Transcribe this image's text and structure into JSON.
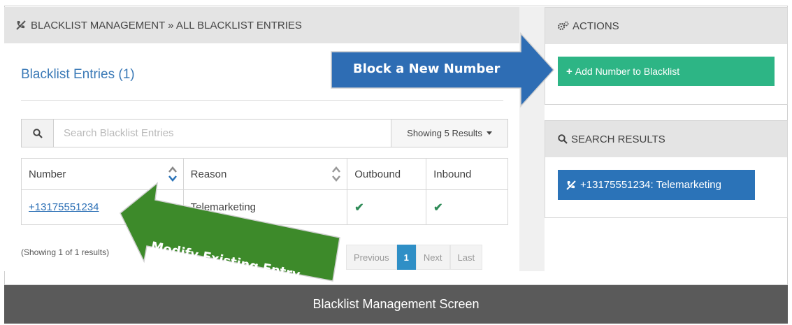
{
  "left_panel": {
    "header": "BLACKLIST MANAGEMENT » ALL BLACKLIST ENTRIES",
    "title": "Blacklist Entries (1)",
    "search": {
      "placeholder": "Search Blacklist Entries",
      "results_dropdown": "Showing 5 Results"
    },
    "table": {
      "columns": [
        "Number",
        "Reason",
        "Outbound",
        "Inbound"
      ],
      "rows": [
        {
          "number": "+13175551234",
          "reason": "Telemarketing",
          "outbound": "✔",
          "inbound": "✔"
        }
      ]
    },
    "showing_text": "(Showing 1 of 1 results)",
    "pagination": {
      "previous": "Previous",
      "current": "1",
      "next": "Next",
      "last": "Last"
    }
  },
  "actions": {
    "header": "ACTIONS",
    "add_button": "Add Number to Blacklist"
  },
  "search_results": {
    "header": "SEARCH RESULTS",
    "result_button": "+13175551234: Telemarketing"
  },
  "annotations": {
    "block_label": "Block a New Number",
    "modify_label": "Modify Existing Entry"
  },
  "caption": "Blacklist Management Screen",
  "colors": {
    "accent_blue": "#2b73b8",
    "add_green": "#2db585",
    "annotation_blue": "#2e6db4",
    "annotation_green": "#3d8a2a",
    "footer_gray": "#5a5a5a"
  },
  "icons": [
    "blacklist-phone-icon",
    "cogs-icon",
    "search-icon",
    "plus-icon",
    "sort-icon",
    "check-icon",
    "caret-down-icon"
  ]
}
